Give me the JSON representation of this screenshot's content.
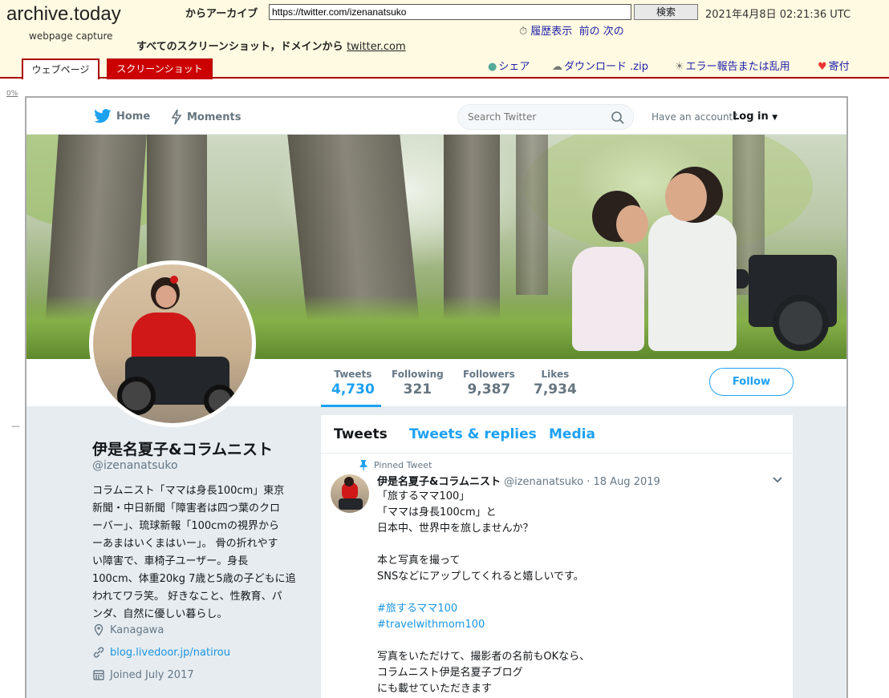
{
  "archive": {
    "logo": "archive.today",
    "subtitle": "webpage capture",
    "from_archive_label": "からアーカイブ",
    "url_value": "https://twitter.com/izenanatsuko",
    "search_button": "検索",
    "datetime": "2021年4月8日 02:21:36 UTC",
    "history": "履歴表示",
    "prev": "前の",
    "next": "次の",
    "all_screenshots_label": "すべてのスクリーンショット，ドメインから",
    "domain_link": "twitter.com",
    "tab_webpage": "ウェブページ",
    "tab_screenshot": "スクリーンショット",
    "share": "シェア",
    "download": "ダウンロード .zip",
    "report": "エラー報告または乱用",
    "donate": "寄付",
    "percent": "0%",
    "dash": "—"
  },
  "twitter": {
    "nav": {
      "home": "Home",
      "moments": "Moments",
      "search_placeholder": "Search Twitter",
      "have_account": "Have an account?",
      "login": "Log in"
    },
    "stats": [
      {
        "label": "Tweets",
        "value": "4,730"
      },
      {
        "label": "Following",
        "value": "321"
      },
      {
        "label": "Followers",
        "value": "9,387"
      },
      {
        "label": "Likes",
        "value": "7,934"
      }
    ],
    "follow_button": "Follow",
    "profile": {
      "name": "伊是名夏子&コラムニスト",
      "handle": "@izenanatsuko",
      "bio_lines": [
        "コラムニスト「ママは身長100cm」東京",
        "新聞・中日新聞「障害者は四つ葉のクロ",
        "ーバー」、琉球新報「100cmの視界から",
        "ーあまはいくまはいー」。 骨の折れやす",
        "い障害で、車椅子ユーザー。身長",
        "100cm、体重20kg 7歳と5歳の子どもに追",
        "われてワラ笑。 好きなこと、性教育、パ",
        "ンダ、自然に優しい暮らし。"
      ],
      "location": "Kanagawa",
      "website": "blog.livedoor.jp/natirou",
      "joined": "Joined July 2017"
    },
    "timeline": {
      "tabs": [
        "Tweets",
        "Tweets & replies",
        "Media"
      ],
      "pinned_label": "Pinned Tweet",
      "tweet": {
        "name": "伊是名夏子&コラムニスト",
        "handle": "@izenanatsuko",
        "sep": "·",
        "date": "18 Aug 2019",
        "lines": [
          "「旅するママ100」",
          "「ママは身長100cm」と",
          "日本中、世界中を旅しませんか？",
          "",
          "本と写真を撮って",
          "SNSなどにアップしてくれると嬉しいです。",
          "",
          "#旅するママ100",
          "#travelwithmom100",
          "",
          "写真をいただけて、撮影者の名前もOKなら、",
          "コラムニスト伊是名夏子ブログ",
          "にも載せていただきます"
        ]
      }
    },
    "colors": {
      "accent": "#1da1f2",
      "link": "#1b95e0",
      "archive_red": "#cc0000"
    }
  }
}
